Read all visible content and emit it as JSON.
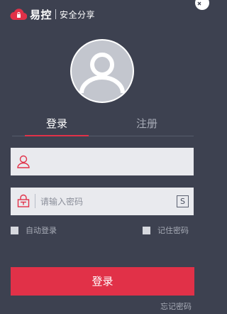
{
  "header": {
    "brand": "易控",
    "slogan": "安全分享"
  },
  "tabs": [
    {
      "label": "登录"
    },
    {
      "label": "注册"
    }
  ],
  "form": {
    "username_value": "",
    "password_placeholder": "请输入密码",
    "keyboard_key": "S"
  },
  "options": {
    "auto_login_label": "自动登录",
    "remember_password_label": "记住密码"
  },
  "actions": {
    "login_label": "登录",
    "forgot_password_label": "忘记密码"
  },
  "colors": {
    "accent": "#e13148",
    "background": "#3d4150",
    "field_bg": "#e9eaee"
  }
}
